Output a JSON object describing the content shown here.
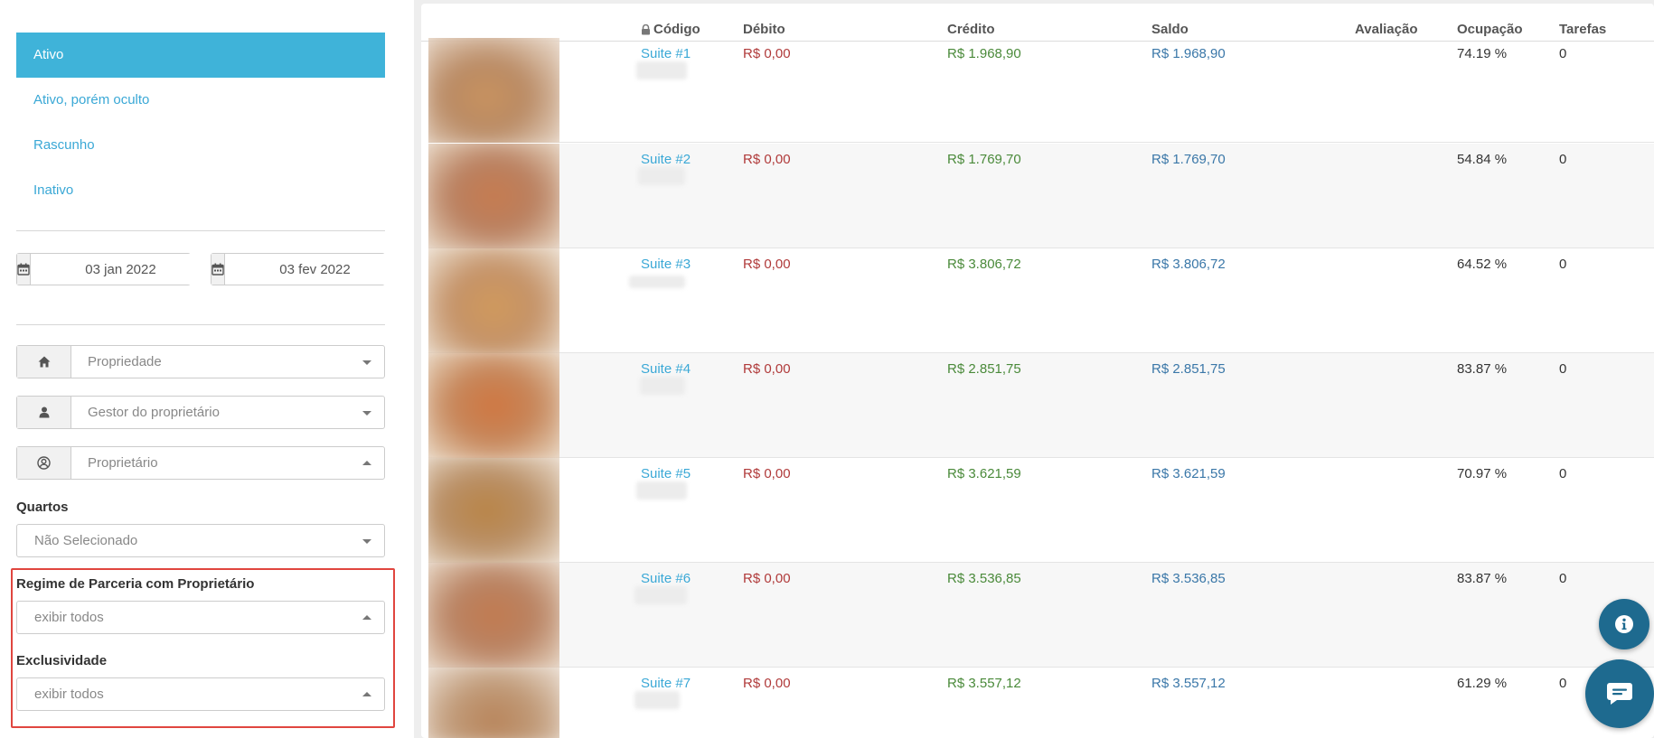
{
  "sidebar": {
    "status_items": [
      {
        "label": "Ativo",
        "active": true
      },
      {
        "label": "Ativo, porém oculto",
        "active": false
      },
      {
        "label": "Rascunho",
        "active": false
      },
      {
        "label": "Inativo",
        "active": false
      }
    ],
    "date_from": "03 jan 2022",
    "date_to": "03 fev 2022",
    "property_placeholder": "Propriedade",
    "owner_manager_placeholder": "Gestor do proprietário",
    "owner_placeholder": "Proprietário",
    "rooms_label": "Quartos",
    "rooms_value": "Não Selecionado",
    "partnership_label": "Regime de Parceria com Proprietário",
    "partnership_value": "exibir todos",
    "exclusivity_label": "Exclusividade",
    "exclusivity_value": "exibir todos"
  },
  "table": {
    "headers": {
      "code": "Código",
      "debit": "Débito",
      "credit": "Crédito",
      "balance": "Saldo",
      "rating": "Avaliação",
      "occupancy": "Ocupação",
      "tasks": "Tarefas"
    },
    "rows": [
      {
        "code": "Suite #1",
        "debit": "R$ 0,00",
        "credit": "R$ 1.968,90",
        "balance": "R$ 1.968,90",
        "rating": "",
        "occupancy": "74.19 %",
        "tasks": "0"
      },
      {
        "code": "Suite #2",
        "debit": "R$ 0,00",
        "credit": "R$ 1.769,70",
        "balance": "R$ 1.769,70",
        "rating": "",
        "occupancy": "54.84 %",
        "tasks": "0"
      },
      {
        "code": "Suite #3",
        "debit": "R$ 0,00",
        "credit": "R$ 3.806,72",
        "balance": "R$ 3.806,72",
        "rating": "",
        "occupancy": "64.52 %",
        "tasks": "0"
      },
      {
        "code": "Suite #4",
        "debit": "R$ 0,00",
        "credit": "R$ 2.851,75",
        "balance": "R$ 2.851,75",
        "rating": "",
        "occupancy": "83.87 %",
        "tasks": "0"
      },
      {
        "code": "Suite #5",
        "debit": "R$ 0,00",
        "credit": "R$ 3.621,59",
        "balance": "R$ 3.621,59",
        "rating": "",
        "occupancy": "70.97 %",
        "tasks": "0"
      },
      {
        "code": "Suite #6",
        "debit": "R$ 0,00",
        "credit": "R$ 3.536,85",
        "balance": "R$ 3.536,85",
        "rating": "",
        "occupancy": "83.87 %",
        "tasks": "0"
      },
      {
        "code": "Suite #7",
        "debit": "R$ 0,00",
        "credit": "R$ 3.557,12",
        "balance": "R$ 3.557,12",
        "rating": "",
        "occupancy": "61.29 %",
        "tasks": "0"
      }
    ]
  },
  "icons": {
    "calendar": "calendar-icon",
    "home": "home-icon",
    "user": "user-icon",
    "user_circle": "user-circle-icon",
    "lock": "lock-icon",
    "info": "info-icon",
    "chat": "chat-icon"
  },
  "colors": {
    "accent": "#3fb3d9",
    "debit": "#b03a3a",
    "credit": "#4a8a3a",
    "balance": "#3a77a8",
    "highlight": "#e0463f",
    "fab": "#1e6a8f"
  }
}
